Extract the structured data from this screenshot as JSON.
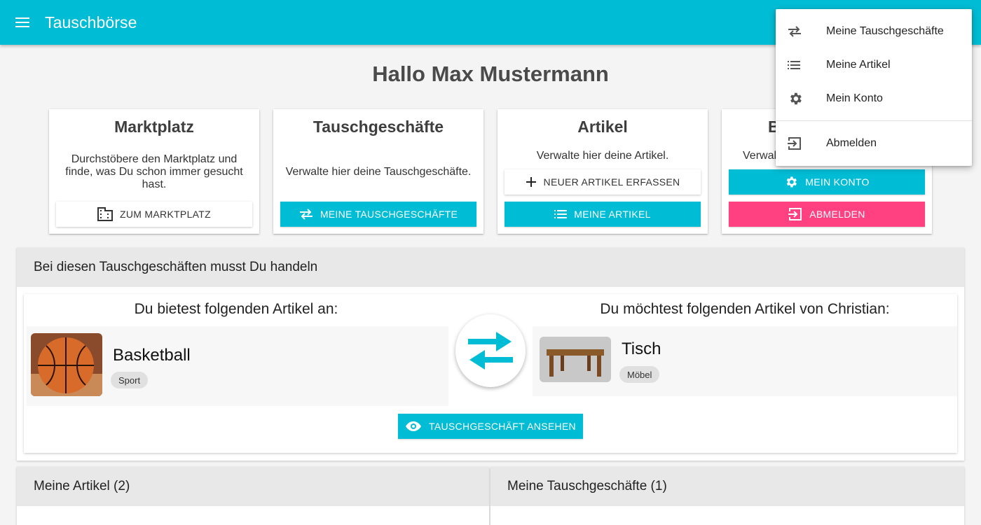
{
  "toolbar": {
    "title": "Tauschbörse",
    "menu_icon": "menu-icon"
  },
  "greeting": "Hallo Max Mustermann",
  "cards": {
    "marktplatz": {
      "title": "Marktplatz",
      "description": "Durchstöbere den Marktplatz und finde, was Du schon immer gesucht hast.",
      "button": "ZUM MARKTPLATZ",
      "icon": "building-icon"
    },
    "tauschgeschaefte": {
      "title": "Tauschgeschäfte",
      "description": "Verwalte hier deine Tauschgeschäfte.",
      "button": "MEINE TAUSCHGESCHÄFTE",
      "icon": "swap-icon"
    },
    "artikel": {
      "title": "Artikel",
      "description": "Verwalte hier deine Artikel.",
      "button_new": "NEUER ARTIKEL ERFASSEN",
      "button": "MEINE ARTIKEL",
      "icon": "list-icon"
    },
    "benutzer": {
      "title": "B",
      "description": "Verwal",
      "button_account": "MEIN KONTO",
      "button_logout": "ABMELDEN"
    }
  },
  "trade_panel": {
    "header": "Bei diesen Tauschgeschäften musst Du handeln",
    "offer_title": "Du bietest folgenden Artikel an:",
    "offer_item": {
      "name": "Basketball",
      "category": "Sport"
    },
    "want_title": "Du möchtest folgenden Artikel von Christian:",
    "want_item": {
      "name": "Tisch",
      "category": "Möbel"
    },
    "view_button": "TAUSCHGESCHÄFT ANSEHEN"
  },
  "bottom": {
    "my_items": "Meine Artikel (2)",
    "my_trades": "Meine Tauschgeschäfte (1)"
  },
  "dropdown": {
    "items": [
      {
        "label": "Meine Tauschgeschäfte",
        "icon": "swap-icon"
      },
      {
        "label": "Meine Artikel",
        "icon": "list-icon"
      },
      {
        "label": "Mein Konto",
        "icon": "gear-icon"
      },
      {
        "label": "Abmelden",
        "icon": "logout-icon"
      }
    ]
  },
  "colors": {
    "primary": "#00bcd4",
    "accent": "#ff4081"
  }
}
